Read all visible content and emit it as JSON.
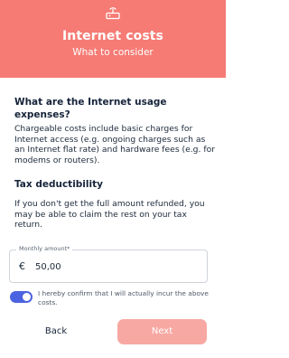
{
  "header": {
    "icon": "router-icon",
    "title": "Internet costs",
    "subtitle": "What to consider"
  },
  "section1": {
    "heading": "What are the Internet usage expenses?",
    "text": "Chargeable costs include basic charges for Internet access (e.g. ongoing charges such as an Internet flat rate) and hardware fees (e.g. for modems or routers)."
  },
  "section2": {
    "heading": "Tax deductibility",
    "text": "If you don't get the full amount refunded, you may be able to claim the rest on your tax return."
  },
  "amount_field": {
    "label": "Monthly amount*",
    "currency": "€",
    "value": "50,00"
  },
  "confirmation": {
    "toggle_on": true,
    "text": "I hereby confirm that I will actually incur the above costs."
  },
  "buttons": {
    "back": "Back",
    "next": "Next"
  },
  "colors": {
    "header_bg": "#f67b74",
    "next_bg": "#f8a8a2",
    "toggle_on": "#4b63e0"
  }
}
